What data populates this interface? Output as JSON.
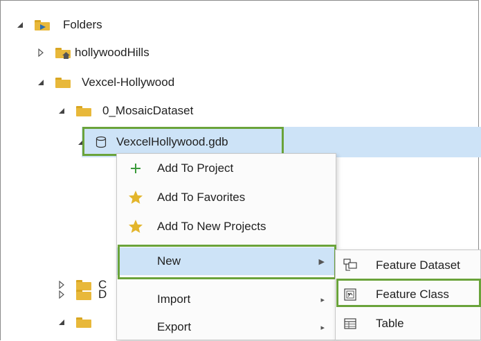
{
  "tree": {
    "folders_label": "Folders",
    "hollywoodhills_label": "hollywoodHills",
    "vexcel_label": "Vexcel-Hollywood",
    "mosaic_label": "0_MosaicDataset",
    "gdb_label": "VexcelHollywood.gdb",
    "c_label": "C",
    "d_label": "D"
  },
  "context_menu": {
    "add_to_project": "Add To Project",
    "add_to_favorites": "Add To Favorites",
    "add_to_new_projects": "Add To New Projects",
    "new": "New",
    "import": "Import",
    "export": "Export"
  },
  "submenu": {
    "feature_dataset": "Feature Dataset",
    "feature_class": "Feature Class",
    "table": "Table"
  },
  "colors": {
    "highlight_border": "#6aa33a",
    "selection": "#cde3f7",
    "folder": "#e8b83a"
  }
}
